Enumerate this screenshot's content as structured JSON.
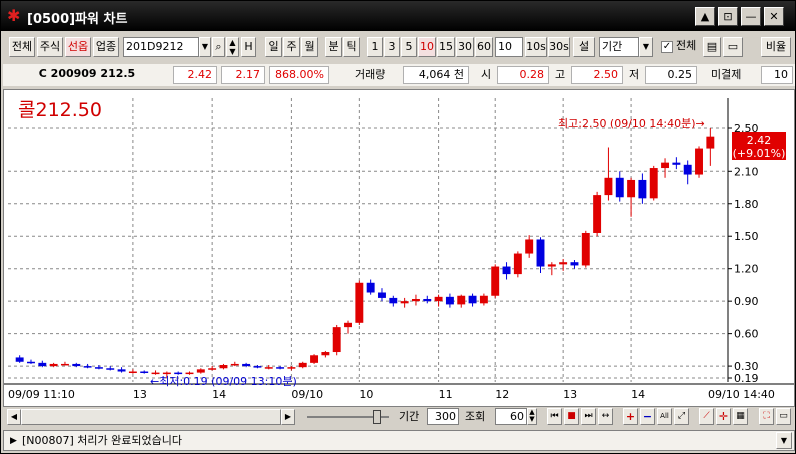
{
  "window": {
    "title": "[0500]파워 차트",
    "buttons": [
      "▲",
      "⊡",
      "—",
      "✕"
    ]
  },
  "toolbar": {
    "categories": [
      "전체",
      "주식",
      "선옵",
      "업종"
    ],
    "active_category": "선옵",
    "code": "201D9212",
    "h_label": "H",
    "period_buttons": [
      "일",
      "주",
      "월",
      "분",
      "틱"
    ],
    "minute_buttons": [
      "1",
      "3",
      "5",
      "10",
      "15",
      "30",
      "60"
    ],
    "active_minute": "10",
    "minute_input": "10",
    "sec_buttons": [
      "10s",
      "30s"
    ],
    "set_button": "설",
    "range_select": "기간",
    "all_check_label": "전체",
    "ratio_button": "비율"
  },
  "info": {
    "instrument": "C 200909 212.5",
    "price": "2.42",
    "change": "2.17",
    "change_pct": "868.00%",
    "volume_label": "거래량",
    "volume": "4,064 천",
    "open_label": "시",
    "open": "0.28",
    "high_label": "고",
    "high": "2.50",
    "low_label": "저",
    "low": "0.25",
    "oi_label": "미결제",
    "oi": "10"
  },
  "chart": {
    "title": "콜212.50",
    "high_annotation": "최고:2.50 (09/10 14:40분)→",
    "low_annotation": "←최저:0.19 (09/09 13:10분)",
    "current_price_label": "2.42",
    "current_change_label": "(+9.01%)",
    "y_ticks": [
      "2.50",
      "2.10",
      "1.80",
      "1.50",
      "1.20",
      "0.90",
      "0.60",
      "0.30",
      "0.19"
    ],
    "x_ticks": [
      "09/09 11:10",
      "13",
      "14",
      "09/10",
      "10",
      "11",
      "12",
      "13",
      "14",
      "09/10 14:40"
    ],
    "up_color": "#e00000",
    "down_color": "#0000e0"
  },
  "chart_data": {
    "type": "candlestick",
    "ylim": [
      0.19,
      2.5
    ],
    "y_ticks": [
      0.19,
      0.3,
      0.6,
      0.9,
      1.2,
      1.5,
      1.8,
      2.1,
      2.5
    ],
    "x_ticks": [
      "09/09 11:10",
      "13",
      "14",
      "09/10",
      "10",
      "11",
      "12",
      "13",
      "14",
      "09/10 14:40"
    ],
    "candles": [
      [
        0.38,
        0.4,
        0.33,
        0.34
      ],
      [
        0.34,
        0.36,
        0.32,
        0.33
      ],
      [
        0.33,
        0.35,
        0.29,
        0.3
      ],
      [
        0.3,
        0.33,
        0.29,
        0.32
      ],
      [
        0.32,
        0.34,
        0.31,
        0.32
      ],
      [
        0.32,
        0.33,
        0.29,
        0.3
      ],
      [
        0.3,
        0.32,
        0.28,
        0.29
      ],
      [
        0.29,
        0.31,
        0.27,
        0.28
      ],
      [
        0.28,
        0.3,
        0.26,
        0.27
      ],
      [
        0.27,
        0.29,
        0.24,
        0.25
      ],
      [
        0.25,
        0.27,
        0.23,
        0.25
      ],
      [
        0.25,
        0.26,
        0.23,
        0.24
      ],
      [
        0.24,
        0.26,
        0.22,
        0.24
      ],
      [
        0.24,
        0.25,
        0.19,
        0.24
      ],
      [
        0.24,
        0.25,
        0.22,
        0.23
      ],
      [
        0.23,
        0.25,
        0.22,
        0.24
      ],
      [
        0.24,
        0.28,
        0.23,
        0.27
      ],
      [
        0.27,
        0.3,
        0.26,
        0.28
      ],
      [
        0.28,
        0.32,
        0.27,
        0.31
      ],
      [
        0.31,
        0.34,
        0.3,
        0.32
      ],
      [
        0.32,
        0.33,
        0.29,
        0.3
      ],
      [
        0.3,
        0.31,
        0.28,
        0.29
      ],
      [
        0.29,
        0.31,
        0.27,
        0.29
      ],
      [
        0.29,
        0.3,
        0.27,
        0.28
      ],
      [
        0.28,
        0.3,
        0.26,
        0.29
      ],
      [
        0.29,
        0.34,
        0.28,
        0.33
      ],
      [
        0.33,
        0.41,
        0.32,
        0.4
      ],
      [
        0.4,
        0.44,
        0.38,
        0.43
      ],
      [
        0.43,
        0.68,
        0.4,
        0.66
      ],
      [
        0.66,
        0.72,
        0.6,
        0.7
      ],
      [
        0.7,
        1.09,
        0.68,
        1.07
      ],
      [
        1.07,
        1.1,
        0.96,
        0.98
      ],
      [
        0.98,
        1.02,
        0.9,
        0.93
      ],
      [
        0.93,
        0.95,
        0.85,
        0.88
      ],
      [
        0.88,
        0.93,
        0.84,
        0.9
      ],
      [
        0.9,
        0.96,
        0.86,
        0.92
      ],
      [
        0.92,
        0.95,
        0.88,
        0.9
      ],
      [
        0.9,
        0.96,
        0.85,
        0.94
      ],
      [
        0.94,
        0.97,
        0.84,
        0.87
      ],
      [
        0.87,
        0.96,
        0.84,
        0.95
      ],
      [
        0.95,
        0.97,
        0.85,
        0.88
      ],
      [
        0.88,
        0.97,
        0.86,
        0.95
      ],
      [
        0.95,
        1.24,
        0.93,
        1.22
      ],
      [
        1.22,
        1.26,
        1.1,
        1.15
      ],
      [
        1.15,
        1.36,
        1.12,
        1.34
      ],
      [
        1.34,
        1.51,
        1.3,
        1.47
      ],
      [
        1.47,
        1.49,
        1.16,
        1.22
      ],
      [
        1.22,
        1.26,
        1.14,
        1.24
      ],
      [
        1.24,
        1.29,
        1.18,
        1.26
      ],
      [
        1.26,
        1.28,
        1.2,
        1.23
      ],
      [
        1.23,
        1.55,
        1.21,
        1.53
      ],
      [
        1.53,
        1.91,
        1.5,
        1.88
      ],
      [
        1.88,
        2.32,
        1.83,
        2.04
      ],
      [
        2.04,
        2.1,
        1.82,
        1.86
      ],
      [
        1.86,
        2.04,
        1.68,
        2.02
      ],
      [
        2.02,
        2.08,
        1.8,
        1.85
      ],
      [
        1.85,
        2.15,
        1.83,
        2.13
      ],
      [
        2.13,
        2.22,
        2.04,
        2.18
      ],
      [
        2.18,
        2.23,
        2.12,
        2.16
      ],
      [
        2.16,
        2.2,
        1.98,
        2.07
      ],
      [
        2.07,
        2.33,
        2.04,
        2.31
      ],
      [
        2.31,
        2.5,
        2.15,
        2.42
      ]
    ]
  },
  "controls": {
    "period_label": "기간",
    "period_value": "300",
    "query_label": "조회",
    "query_value": "60"
  },
  "status": {
    "message": "[N00807] 처리가 완료되었습니다"
  }
}
